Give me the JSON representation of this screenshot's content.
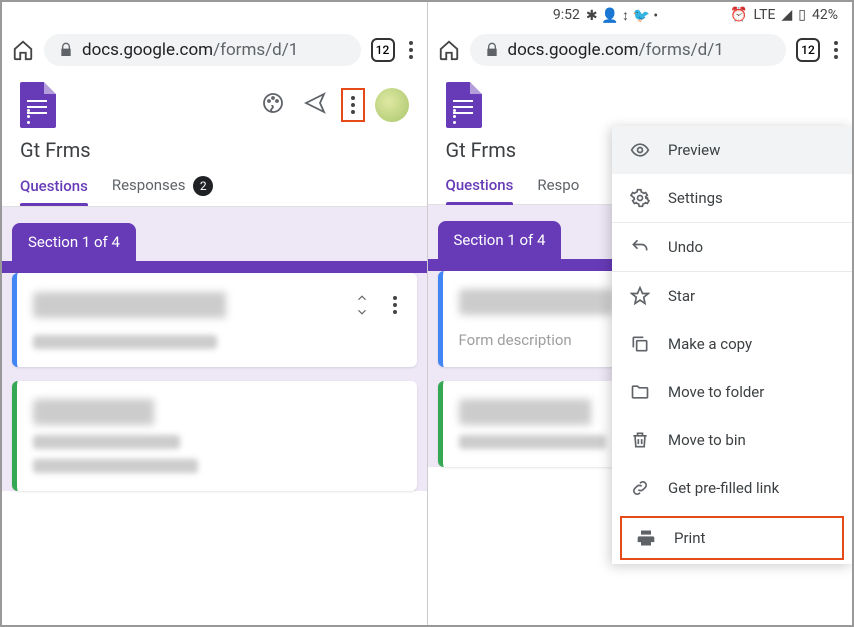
{
  "status": {
    "time": "9:52",
    "lte": "LTE",
    "battery": "42%"
  },
  "url": {
    "host": "docs.google.com",
    "path": "/forms/d/1",
    "tab_count": "12"
  },
  "form": {
    "title": "Gt Frms",
    "tabs": {
      "questions": "Questions",
      "responses": "Responses",
      "responses_count": "2"
    },
    "section_label": "Section 1 of 4",
    "description_placeholder": "Form description"
  },
  "menu": {
    "preview": "Preview",
    "settings": "Settings",
    "undo": "Undo",
    "star": "Star",
    "make_copy": "Make a copy",
    "move_folder": "Move to folder",
    "move_bin": "Move to bin",
    "prefilled": "Get pre-filled link",
    "print": "Print"
  }
}
